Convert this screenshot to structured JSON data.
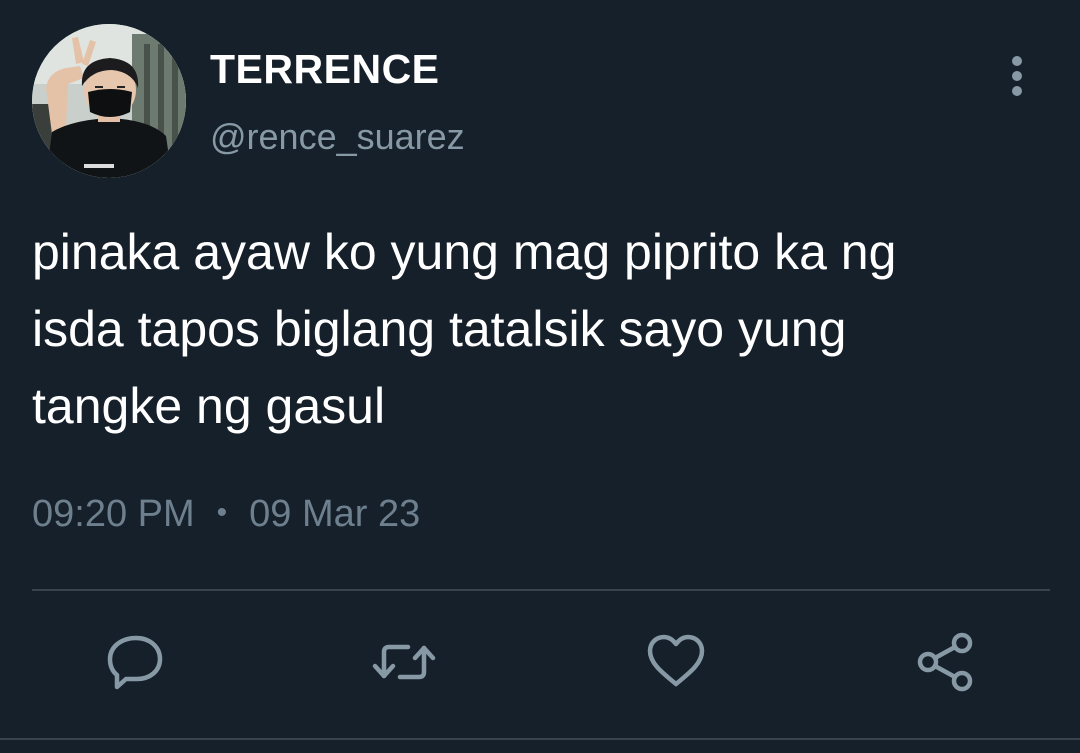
{
  "author": {
    "name": "TERRENCE",
    "handle": "@rence_suarez"
  },
  "tweet": {
    "text": "pinaka ayaw ko yung mag piprito ka ng\nisda tapos biglang tatalsik sayo yung\ntangke ng gasul",
    "time": "09:20 PM",
    "separator": "•",
    "date": "09 Mar 23"
  },
  "actions": [
    {
      "icon": "reply-icon"
    },
    {
      "icon": "retweet-icon"
    },
    {
      "icon": "heart-icon"
    },
    {
      "icon": "share-icon"
    }
  ],
  "menu": {
    "icon": "more-vertical-icon"
  },
  "colors": {
    "background": "#15202b",
    "primary_text": "#ffffff",
    "secondary_text": "#8899a6",
    "icon": "#8899a6",
    "divider": "#38444d"
  }
}
